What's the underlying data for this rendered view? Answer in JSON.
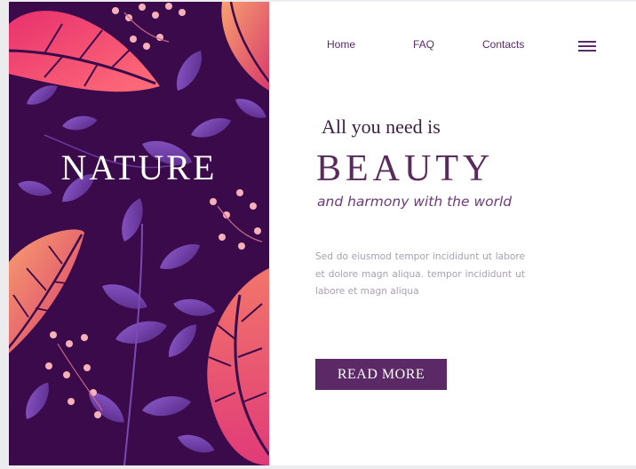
{
  "colors": {
    "brand_purple": "#5b2966",
    "art_background": "#3a0a4a",
    "pink_leaf": "#f0457a",
    "coral_leaf": "#f8a070",
    "violet_leaf": "#7a4ab0"
  },
  "hero_art": {
    "title": "NATURE",
    "decoration": "botanical-leaves-illustration"
  },
  "nav": {
    "links": [
      "Home",
      "FAQ",
      "Contacts"
    ],
    "menu_icon": "hamburger-menu-icon"
  },
  "content": {
    "headline_small": "All you need is",
    "headline_big": "BEAUTY",
    "tagline": "and harmony with the world",
    "body": "Sed do eiusmod tempor incididunt ut labore et dolore magn aliqua. tempor incididunt ut labore et magn aliqua",
    "button_label": "READ MORE"
  }
}
